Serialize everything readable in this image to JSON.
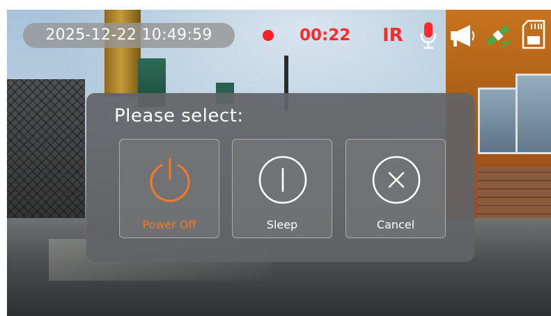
{
  "status_bar": {
    "datetime": "2025-12-22 10:49:59",
    "recording_time": "00:22",
    "ir_label": "IR",
    "icons": [
      "recording-dot-icon",
      "microphone-icon",
      "speaker-icon",
      "gps-satellite-icon",
      "sd-card-icon"
    ]
  },
  "dialog": {
    "title": "Please select:",
    "options": [
      {
        "label": "Power Off",
        "icon": "power-icon",
        "selected": true
      },
      {
        "label": "Sleep",
        "icon": "sleep-icon",
        "selected": false
      },
      {
        "label": "Cancel",
        "icon": "cancel-icon",
        "selected": false
      }
    ]
  },
  "colors": {
    "recording_red": "#ff2a2a",
    "accent_orange": "#f07a2a",
    "dialog_bg": "#626366",
    "text_white": "#ffffff"
  }
}
